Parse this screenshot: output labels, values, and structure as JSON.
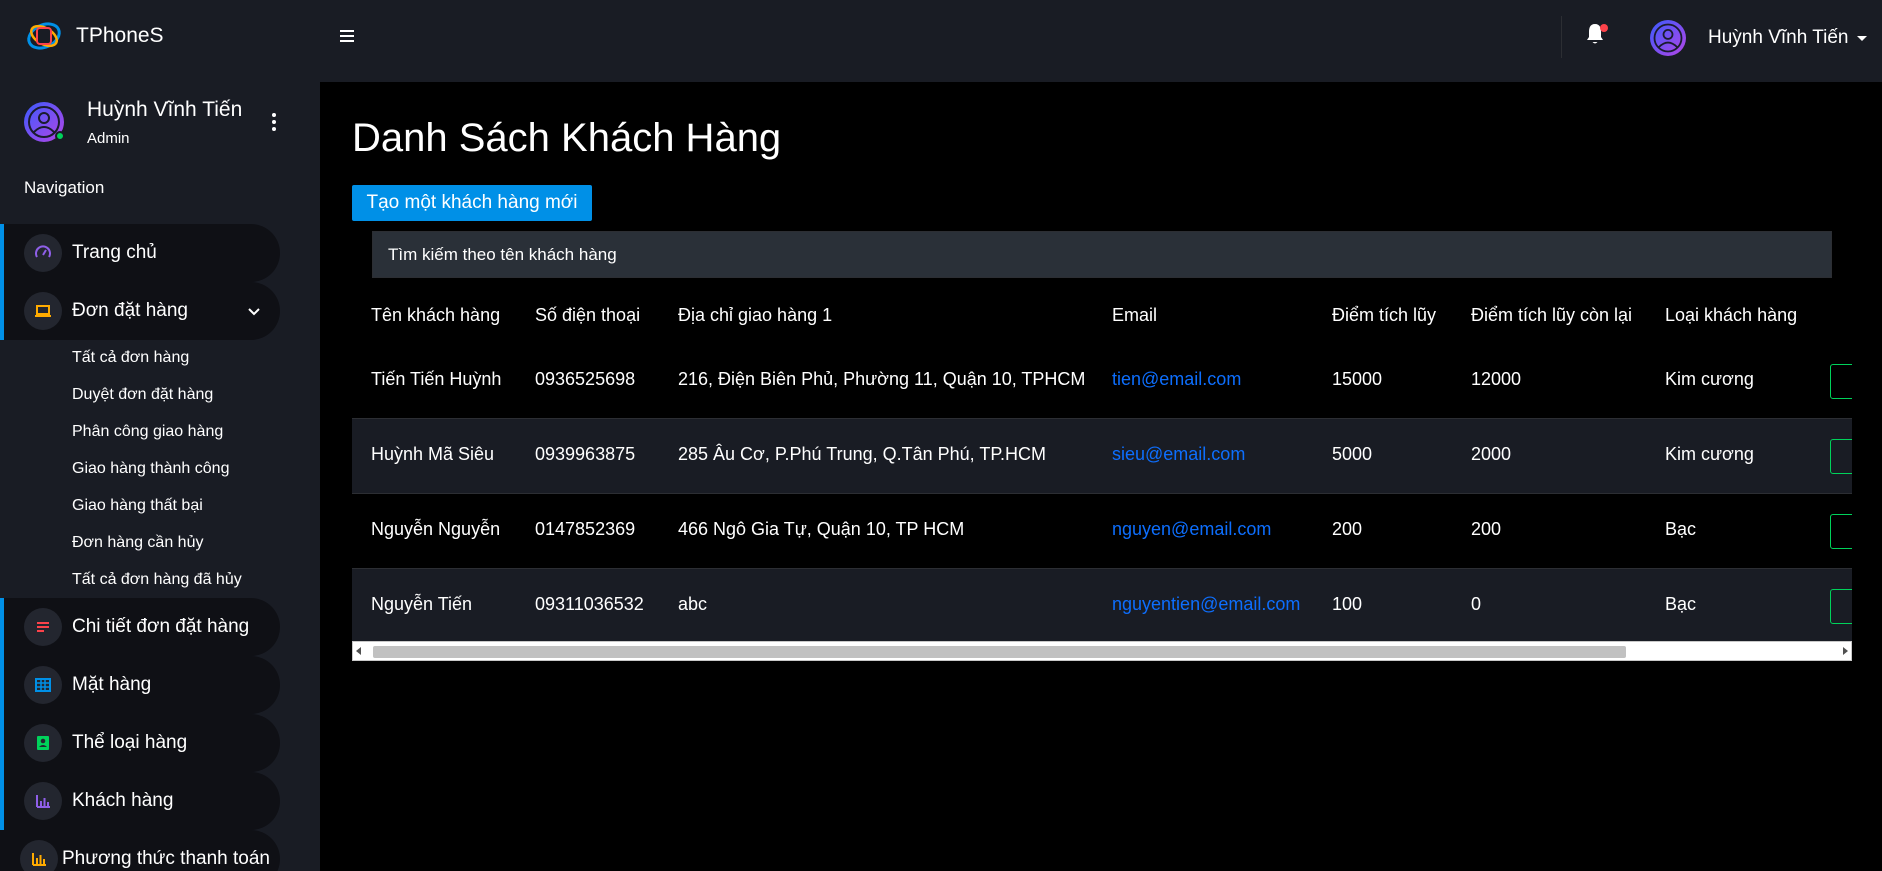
{
  "brand": {
    "name": "TPhoneS"
  },
  "profile": {
    "name": "Huỳnh Vĩnh Tiến",
    "role": "Admin"
  },
  "nav": {
    "heading": "Navigation",
    "items": [
      {
        "label": "Trang chủ",
        "icon": "speedometer-icon",
        "color": "#8f5fe8"
      },
      {
        "label": "Đơn đặt hàng",
        "icon": "laptop-icon",
        "color": "#ffab00"
      },
      {
        "label": "Chi tiết đơn đặt hàng",
        "icon": "list-icon",
        "color": "#fc424a"
      },
      {
        "label": "Mặt hàng",
        "icon": "table-icon",
        "color": "#0090e7"
      },
      {
        "label": "Thể loại hàng",
        "icon": "contacts-icon",
        "color": "#00d25b"
      },
      {
        "label": "Khách hàng",
        "icon": "chart-bar-icon",
        "color": "#8f5fe8"
      },
      {
        "label": "Phương thức thanh toán",
        "icon": "chart-bar-icon",
        "color": "#ffab00"
      }
    ],
    "submenu": [
      "Tất cả đơn hàng",
      "Duyệt đơn đặt hàng",
      "Phân công giao hàng",
      "Giao hàng thành công",
      "Giao hàng thất bại",
      "Đơn hàng cần hủy",
      "Tất cả đơn hàng đã hủy"
    ]
  },
  "topbar": {
    "user_name": "Huỳnh Vĩnh Tiến"
  },
  "main": {
    "title": "Danh Sách Khách Hàng",
    "create_button": "Tạo một khách hàng mới",
    "search_placeholder": "Tìm kiếm theo tên khách hàng"
  },
  "table": {
    "columns": [
      "Tên khách hàng",
      "Số điện thoại",
      "Địa chỉ giao hàng 1",
      "Email",
      "Điểm tích lũy",
      "Điểm tích lũy còn lại",
      "Loại khách hàng"
    ],
    "rows": [
      [
        "Tiến Tiến Huỳnh",
        "0936525698",
        "216, Điện Biên Phủ, Phường 11, Quận 10, TPHCM",
        "tien@email.com",
        "15000",
        "12000",
        "Kim cương"
      ],
      [
        "Huỳnh Mã Siêu",
        "0939963875",
        "285 Âu Cơ, P.Phú Trung, Q.Tân Phú, TP.HCM",
        "sieu@email.com",
        "5000",
        "2000",
        "Kim cương"
      ],
      [
        "Nguyễn Nguyễn",
        "0147852369",
        "466 Ngô Gia Tự, Quận 10, TP HCM",
        "nguyen@email.com",
        "200",
        "200",
        "Bạc"
      ],
      [
        "Nguyễn Tiến",
        "09311036532",
        "abc",
        "nguyentien@email.com",
        "100",
        "0",
        "Bạc"
      ]
    ]
  },
  "colors": {
    "sidebar_bg": "#191c24",
    "accent": "#0090e7",
    "link": "#0d6efd",
    "success": "#00d25b",
    "danger": "#fc424a"
  }
}
